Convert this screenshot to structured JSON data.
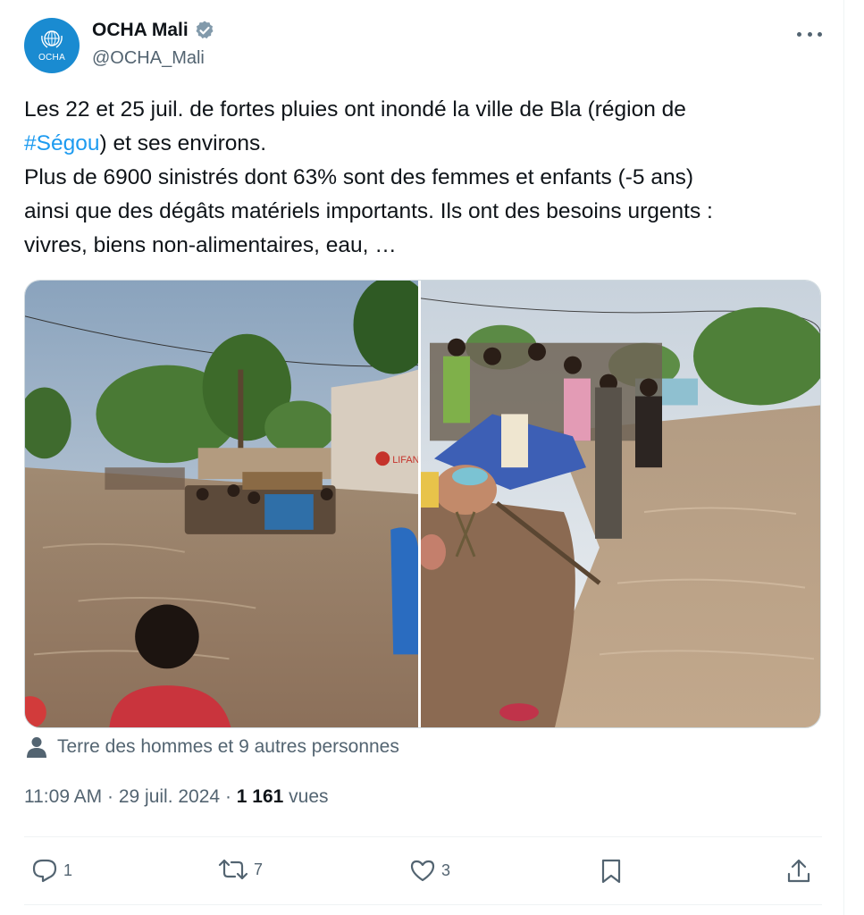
{
  "account": {
    "display_name": "OCHA Mali",
    "handle": "@OCHA_Mali",
    "avatar_text": "OCHA",
    "verified_icon": "verified-badge-icon",
    "accent_color": "#1a8bd1"
  },
  "tweet": {
    "lines": [
      {
        "pre": "Les 22 et 25 juil. de fortes pluies ont inondé la ville de Bla (région de"
      },
      {
        "hashtag": "#Ségou",
        "post": ") et ses environs."
      },
      {
        "pre": "Plus de 6900 sinistrés dont 63% sont des femmes et enfants (-5 ans)"
      },
      {
        "pre": "ainsi que des dégâts matériels importants. Ils ont des besoins urgents :"
      },
      {
        "pre": "vivres, biens non-alimentaires, eau, …"
      }
    ],
    "hashtag_color": "#1d9bf0"
  },
  "media": {
    "photo_left": "flooded-street-photo",
    "photo_right": "flooded-street-household-items-photo"
  },
  "tagged": {
    "icon": "person-icon",
    "text": "Terre des hommes et 9 autres personnes"
  },
  "meta": {
    "time": "11:09 AM",
    "sep1": " · ",
    "date": "29 juil. 2024",
    "sep2": " · ",
    "views_count": "1 161",
    "views_label": " vues"
  },
  "actions": {
    "reply_count": "1",
    "retweet_count": "7",
    "like_count": "3",
    "reply_icon": "reply-icon",
    "retweet_icon": "retweet-icon",
    "like_icon": "heart-icon",
    "bookmark_icon": "bookmark-icon",
    "share_icon": "share-icon"
  }
}
